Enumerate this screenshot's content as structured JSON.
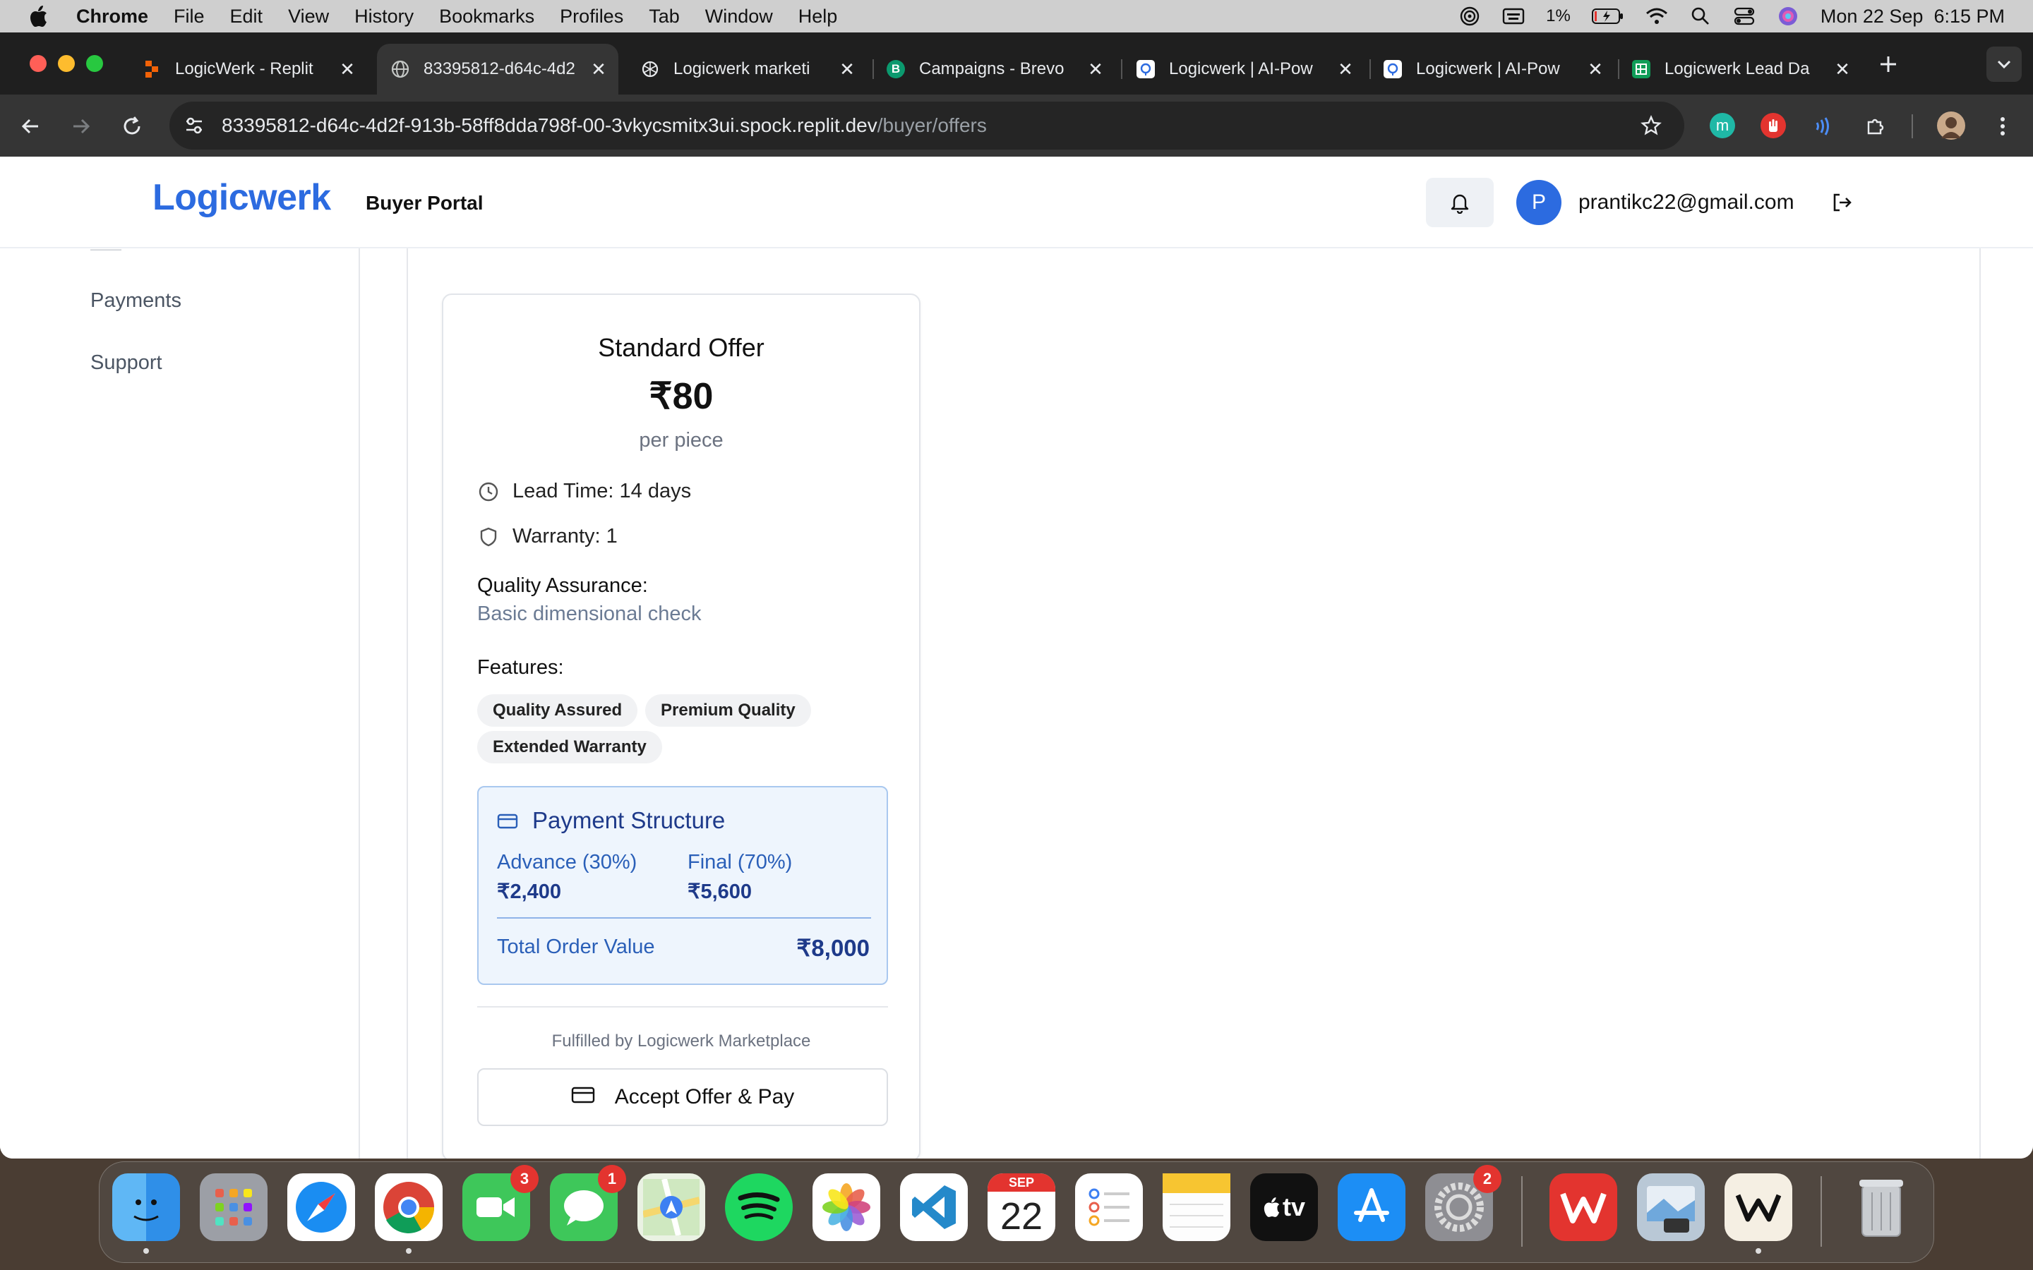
{
  "menubar": {
    "app": "Chrome",
    "items": [
      "File",
      "Edit",
      "View",
      "History",
      "Bookmarks",
      "Profiles",
      "Tab",
      "Window",
      "Help"
    ],
    "battery": "1%",
    "clock": "Mon 22 Sep  6:15 PM"
  },
  "tabs": [
    {
      "title": "LogicWerk - Replit",
      "icon": "replit-icon",
      "color": "#f26207"
    },
    {
      "title": "83395812-d64c-4d2f",
      "icon": "globe-icon",
      "color": "#9aa0a6"
    },
    {
      "title": "Logicwerk marketi",
      "icon": "openai-icon",
      "color": "#e8eaed"
    },
    {
      "title": "Campaigns - Brevo",
      "icon": "brevo-icon",
      "color": "#0b996e"
    },
    {
      "title": "Logicwerk | AI-Pow",
      "icon": "site-icon",
      "color": "#ffffff"
    },
    {
      "title": "Logicwerk | AI-Pow",
      "icon": "site-icon",
      "color": "#ffffff"
    },
    {
      "title": "Logicwerk Lead Da",
      "icon": "sheets-icon",
      "color": "#0f9d58"
    }
  ],
  "address": {
    "host": "83395812-d64c-4d2f-913b-58ff8dda798f-00-3vkycsmitx3ui.spock.replit.dev",
    "path": "/buyer/offers"
  },
  "header": {
    "logo": "Logicwerk",
    "portal": "Buyer Portal",
    "avatar_initial": "P",
    "email": "prantikc22@gmail.com"
  },
  "sidebar": {
    "items": [
      "Payments",
      "Support"
    ]
  },
  "offer": {
    "title": "Standard Offer",
    "price": "₹80",
    "unit": "per piece",
    "lead_time": "Lead Time: 14 days",
    "warranty": "Warranty: 1",
    "qa_label": "Quality Assurance:",
    "qa_value": "Basic dimensional check",
    "features_label": "Features:",
    "features": [
      "Quality Assured",
      "Premium Quality",
      "Extended Warranty"
    ],
    "payment": {
      "title": "Payment Structure",
      "advance_label": "Advance (30%)",
      "advance_value": "₹2,400",
      "final_label": "Final (70%)",
      "final_value": "₹5,600",
      "total_label": "Total Order Value",
      "total_value": "₹8,000"
    },
    "fulfilled": "Fulfilled by Logicwerk Marketplace",
    "accept_label": "Accept Offer & Pay"
  },
  "dock": {
    "calendar_month": "SEP",
    "calendar_day": "22",
    "facetime_badge": "3",
    "messages_badge": "1",
    "settings_badge": "2",
    "tv_label": "tv"
  }
}
